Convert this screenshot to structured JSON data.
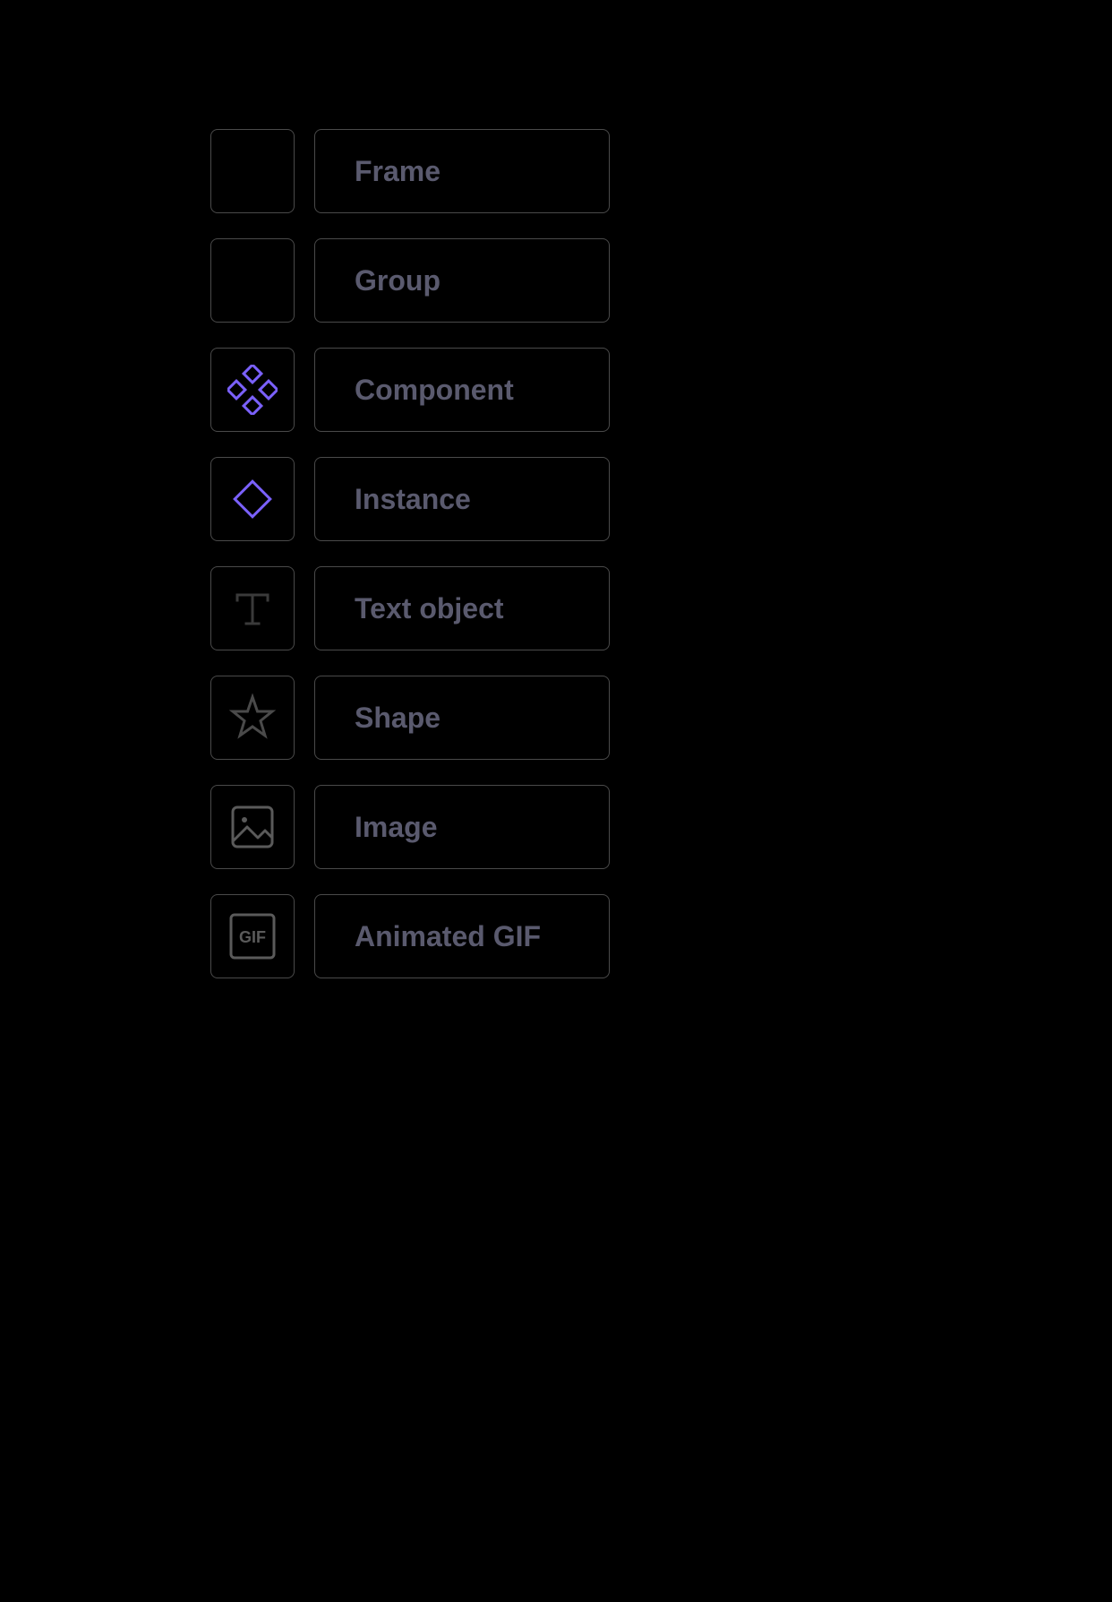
{
  "items": [
    {
      "label": "Frame"
    },
    {
      "label": "Group"
    },
    {
      "label": "Component"
    },
    {
      "label": "Instance"
    },
    {
      "label": "Text object"
    },
    {
      "label": "Shape"
    },
    {
      "label": "Image"
    },
    {
      "label": "Animated GIF"
    }
  ],
  "colors": {
    "accent": "#7b61ff",
    "muted": "#4a4a4a",
    "label": "#5a5a6e"
  }
}
